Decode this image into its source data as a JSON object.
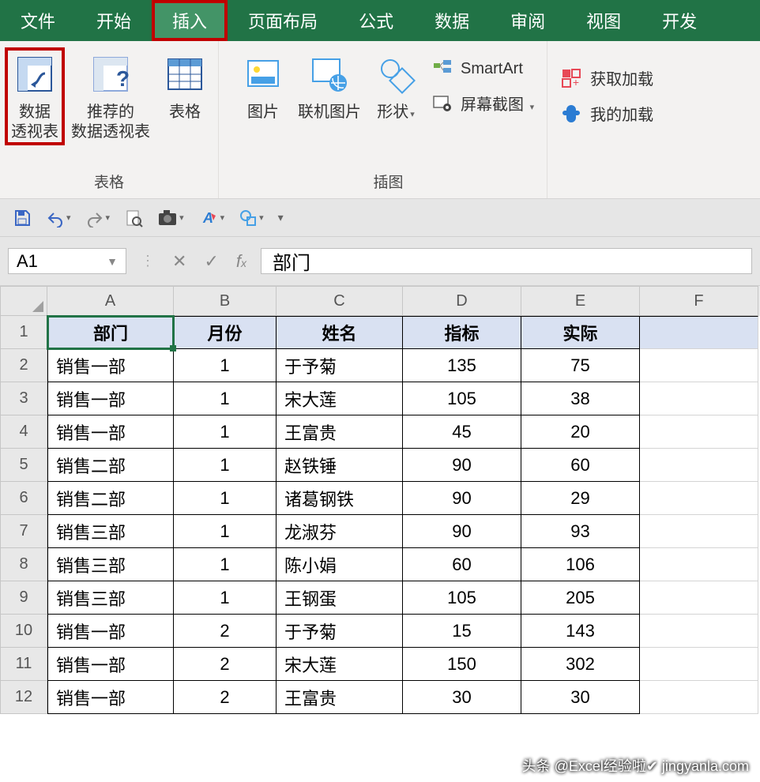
{
  "ribbon": {
    "tabs": [
      "文件",
      "开始",
      "插入",
      "页面布局",
      "公式",
      "数据",
      "审阅",
      "视图",
      "开发"
    ],
    "active_index": 2,
    "groups": {
      "tables": {
        "label": "表格",
        "pivot": "数据\n透视表",
        "recommended_pivot": "推荐的\n数据透视表",
        "table": "表格"
      },
      "illustrations": {
        "label": "插图",
        "pictures": "图片",
        "online_pictures": "联机图片",
        "shapes": "形状",
        "smartart": "SmartArt",
        "screenshot": "屏幕截图"
      },
      "addins": {
        "get": "获取加载",
        "my": "我的加载"
      }
    }
  },
  "namebox": "A1",
  "formula_value": "部门",
  "columns": [
    "A",
    "B",
    "C",
    "D",
    "E",
    "F"
  ],
  "headers": [
    "部门",
    "月份",
    "姓名",
    "指标",
    "实际"
  ],
  "rows": [
    {
      "n": "1",
      "dept": "部门",
      "month": "月份",
      "name": "姓名",
      "target": "指标",
      "actual": "实际",
      "is_header": true
    },
    {
      "n": "2",
      "dept": "销售一部",
      "month": "1",
      "name": "于予菊",
      "target": "135",
      "actual": "75"
    },
    {
      "n": "3",
      "dept": "销售一部",
      "month": "1",
      "name": "宋大莲",
      "target": "105",
      "actual": "38"
    },
    {
      "n": "4",
      "dept": "销售一部",
      "month": "1",
      "name": "王富贵",
      "target": "45",
      "actual": "20"
    },
    {
      "n": "5",
      "dept": "销售二部",
      "month": "1",
      "name": "赵铁锤",
      "target": "90",
      "actual": "60"
    },
    {
      "n": "6",
      "dept": "销售二部",
      "month": "1",
      "name": "诸葛钢铁",
      "target": "90",
      "actual": "29"
    },
    {
      "n": "7",
      "dept": "销售三部",
      "month": "1",
      "name": "龙淑芬",
      "target": "90",
      "actual": "93"
    },
    {
      "n": "8",
      "dept": "销售三部",
      "month": "1",
      "name": "陈小娟",
      "target": "60",
      "actual": "106"
    },
    {
      "n": "9",
      "dept": "销售三部",
      "month": "1",
      "name": "王钢蛋",
      "target": "105",
      "actual": "205"
    },
    {
      "n": "10",
      "dept": "销售一部",
      "month": "2",
      "name": "于予菊",
      "target": "15",
      "actual": "143"
    },
    {
      "n": "11",
      "dept": "销售一部",
      "month": "2",
      "name": "宋大莲",
      "target": "150",
      "actual": "302"
    },
    {
      "n": "12",
      "dept": "销售一部",
      "month": "2",
      "name": "王富贵",
      "target": "30",
      "actual": "30"
    }
  ],
  "watermark": "头条 @Excel经验啦✔ jingyanla.com"
}
